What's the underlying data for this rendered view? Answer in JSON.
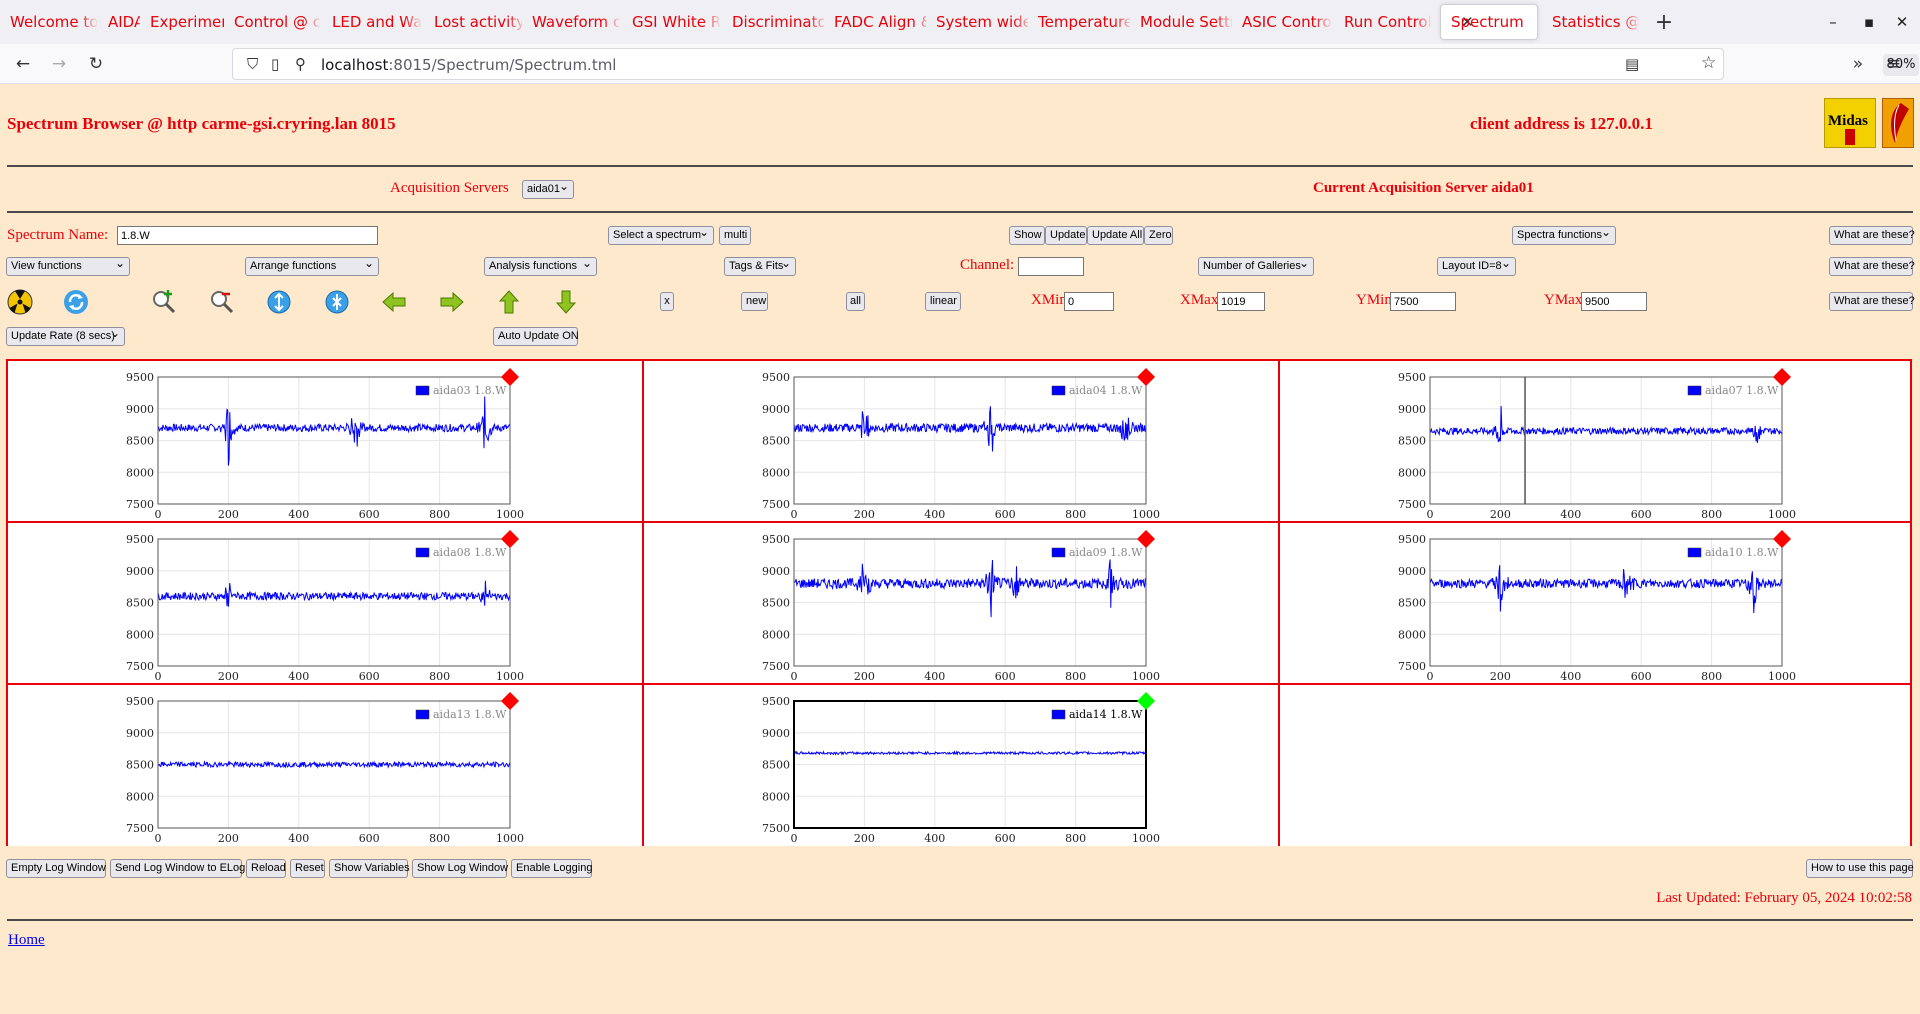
{
  "browser": {
    "tabs": [
      {
        "label": "Welcome to"
      },
      {
        "label": "AIDA"
      },
      {
        "label": "Experiment C"
      },
      {
        "label": "Control @ c"
      },
      {
        "label": "LED and Wa"
      },
      {
        "label": "Lost activity"
      },
      {
        "label": "Waveform c"
      },
      {
        "label": "GSI White R"
      },
      {
        "label": "Discriminato"
      },
      {
        "label": "FADC Align &"
      },
      {
        "label": "System wide"
      },
      {
        "label": "Temperature"
      },
      {
        "label": "Module Setti"
      },
      {
        "label": "ASIC Contro"
      },
      {
        "label": "Run Control"
      },
      {
        "label": "Spectrum"
      },
      {
        "label": "Statistics @"
      }
    ],
    "url_host": "localhost",
    "url_rest": ":8015/Spectrum/Spectrum.tml",
    "zoom": "80%"
  },
  "header": {
    "title": "Spectrum Browser @ http carme-gsi.cryring.lan 8015",
    "client": "client address is 127.0.0.1",
    "acq_servers_label": "Acquisition Servers",
    "acq_server_value": "aida01",
    "current_server": "Current Acquisition Server aida01",
    "logo_midas": "Midas",
    "logo_tcl": "TCL"
  },
  "controls": {
    "spectrum_name_label": "Spectrum Name:",
    "spectrum_name_value": "1.8.W",
    "select_spectrum": "Select a spectrum",
    "multi": "multi",
    "show": "Show",
    "update": "Update",
    "update_all": "Update All",
    "zero": "Zero",
    "spectra_functions": "Spectra functions",
    "what1": "What are these?",
    "view_functions": "View functions",
    "arrange_functions": "Arrange functions",
    "analysis_functions": "Analysis functions",
    "tags_fits": "Tags & Fits",
    "channel_label": "Channel:",
    "channel_value": "",
    "number_galleries": "Number of Galleries",
    "layout_id": "Layout ID=8",
    "what2": "What are these?",
    "x_btn": "x",
    "new_btn": "new",
    "all_btn": "all",
    "linear_btn": "linear",
    "xmin_label": "XMin",
    "xmin_value": "0",
    "xmax_label": "XMax",
    "xmax_value": "1019",
    "ymin_label": "YMin",
    "ymin_value": "7500",
    "ymax_label": "YMax",
    "ymax_value": "9500",
    "what3": "What are these?",
    "update_rate": "Update Rate (8 secs)",
    "auto_update": "Auto Update ON"
  },
  "toolbar_icons": [
    "radiation-icon",
    "refresh-icon",
    "zoom-in-icon",
    "zoom-out-icon",
    "expand-y-icon",
    "compress-y-icon",
    "arrow-left-icon",
    "arrow-right-icon",
    "arrow-up-icon",
    "arrow-down-icon"
  ],
  "colors": {
    "accent_red": "#e8000b",
    "trace_blue": "#0000ff",
    "marker_red": "#ff0000",
    "marker_green": "#00ff00",
    "page_bg": "#ffe9cc"
  },
  "chart_data": [
    {
      "type": "line",
      "series": [
        {
          "name": "aida03 1.8.W"
        }
      ],
      "xlim": [
        0,
        1000
      ],
      "ylim": [
        7500,
        9500
      ],
      "x_ticks": [
        "0",
        "200",
        "400",
        "600",
        "800",
        "1000"
      ],
      "y_ticks": [
        "9500",
        "9000",
        "8500",
        "8000",
        "7500"
      ],
      "baseline": 8700,
      "noise": 60,
      "bursts": [
        [
          200,
          600
        ],
        [
          560,
          520
        ],
        [
          930,
          600
        ]
      ],
      "status": "red",
      "selected": false
    },
    {
      "type": "line",
      "series": [
        {
          "name": "aida04 1.8.W"
        }
      ],
      "xlim": [
        0,
        1000
      ],
      "ylim": [
        7500,
        9500
      ],
      "x_ticks": [
        "0",
        "200",
        "400",
        "600",
        "800",
        "1000"
      ],
      "y_ticks": [
        "9500",
        "9000",
        "8500",
        "8000",
        "7500"
      ],
      "baseline": 8700,
      "noise": 70,
      "bursts": [
        [
          200,
          550
        ],
        [
          560,
          600
        ],
        [
          940,
          400
        ]
      ],
      "status": "red",
      "selected": false
    },
    {
      "type": "line",
      "series": [
        {
          "name": "aida07 1.8.W"
        }
      ],
      "xlim": [
        0,
        1000
      ],
      "ylim": [
        7500,
        9500
      ],
      "x_ticks": [
        "0",
        "200",
        "400",
        "600",
        "800",
        "1000"
      ],
      "y_ticks": [
        "9500",
        "9000",
        "8500",
        "8000",
        "7500"
      ],
      "baseline": 8650,
      "noise": 55,
      "bursts": [
        [
          200,
          500
        ],
        [
          930,
          220
        ]
      ],
      "status": "red",
      "selected": false,
      "cursor_x": 270
    },
    {
      "type": "line",
      "series": [
        {
          "name": "aida08 1.8.W"
        }
      ],
      "xlim": [
        0,
        1000
      ],
      "ylim": [
        7500,
        9500
      ],
      "x_ticks": [
        "0",
        "200",
        "400",
        "600",
        "800",
        "1000"
      ],
      "y_ticks": [
        "9500",
        "9000",
        "8500",
        "8000",
        "7500"
      ],
      "baseline": 8600,
      "noise": 60,
      "bursts": [
        [
          200,
          300
        ],
        [
          930,
          250
        ]
      ],
      "status": "red",
      "selected": false
    },
    {
      "type": "line",
      "series": [
        {
          "name": "aida09 1.8.W"
        }
      ],
      "xlim": [
        0,
        1000
      ],
      "ylim": [
        7500,
        9500
      ],
      "x_ticks": [
        "0",
        "200",
        "400",
        "600",
        "800",
        "1000"
      ],
      "y_ticks": [
        "9500",
        "9000",
        "8500",
        "8000",
        "7500"
      ],
      "baseline": 8800,
      "noise": 80,
      "bursts": [
        [
          200,
          650
        ],
        [
          560,
          600
        ],
        [
          630,
          500
        ],
        [
          900,
          550
        ]
      ],
      "status": "red",
      "selected": false
    },
    {
      "type": "line",
      "series": [
        {
          "name": "aida10 1.8.W"
        }
      ],
      "xlim": [
        0,
        1000
      ],
      "ylim": [
        7500,
        9500
      ],
      "x_ticks": [
        "0",
        "200",
        "400",
        "600",
        "800",
        "1000"
      ],
      "y_ticks": [
        "9500",
        "9000",
        "8500",
        "8000",
        "7500"
      ],
      "baseline": 8800,
      "noise": 70,
      "bursts": [
        [
          200,
          650
        ],
        [
          560,
          600
        ],
        [
          920,
          650
        ]
      ],
      "status": "red",
      "selected": false
    },
    {
      "type": "line",
      "series": [
        {
          "name": "aida13 1.8.W"
        }
      ],
      "xlim": [
        0,
        1000
      ],
      "ylim": [
        7500,
        9500
      ],
      "x_ticks": [
        "0",
        "200",
        "400",
        "600",
        "800",
        "1000"
      ],
      "y_ticks": [
        "9500",
        "9000",
        "8500",
        "8000",
        "7500"
      ],
      "baseline": 8500,
      "noise": 40,
      "bursts": [],
      "status": "red",
      "selected": false
    },
    {
      "type": "line",
      "series": [
        {
          "name": "aida14 1.8.W"
        }
      ],
      "xlim": [
        0,
        1000
      ],
      "ylim": [
        7500,
        9500
      ],
      "x_ticks": [
        "0",
        "200",
        "400",
        "600",
        "800",
        "1000"
      ],
      "y_ticks": [
        "9500",
        "9000",
        "8500",
        "8000",
        "7500"
      ],
      "baseline": 8680,
      "noise": 20,
      "bursts": [],
      "status": "green",
      "selected": true
    }
  ],
  "footer": {
    "empty_log": "Empty Log Window",
    "send_log": "Send Log Window to ELog",
    "reload": "Reload",
    "reset": "Reset",
    "show_vars": "Show Variables",
    "show_log": "Show Log Window",
    "enable_logging": "Enable Logging",
    "how_to": "How to use this page",
    "last_updated": "Last Updated: February 05, 2024 10:02:58",
    "home": "Home"
  }
}
